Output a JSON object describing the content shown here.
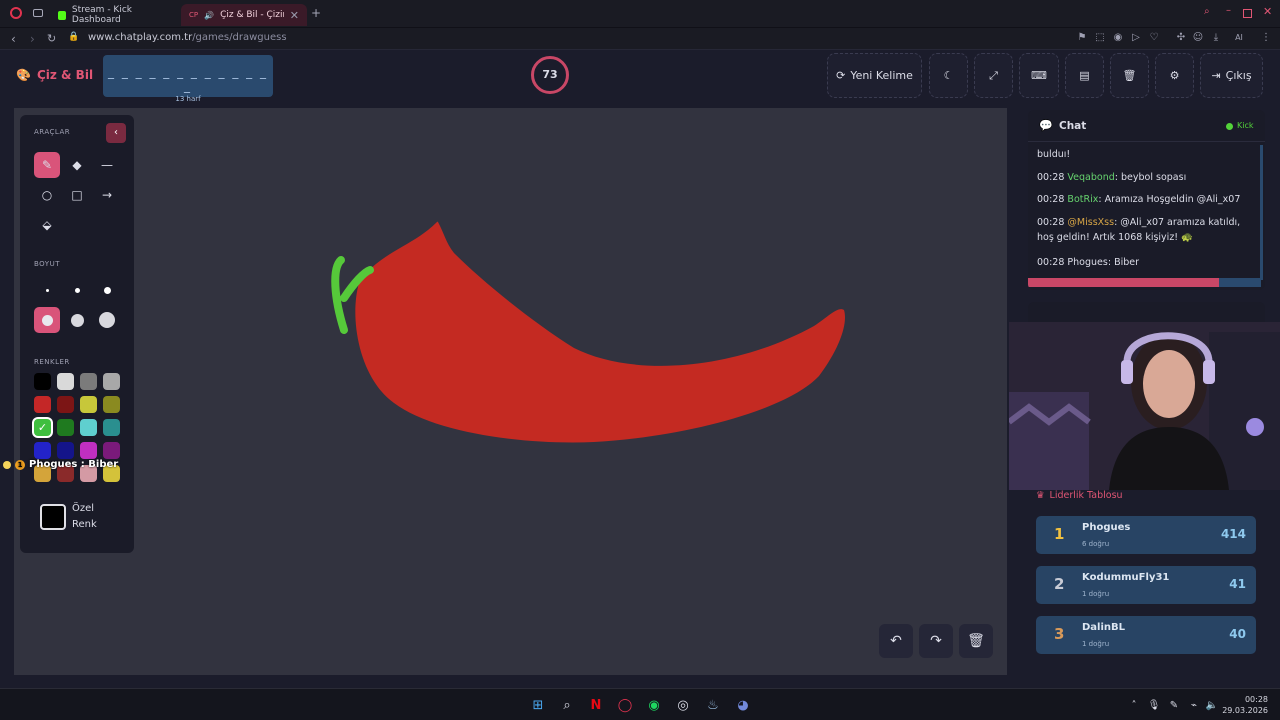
{
  "browser": {
    "tabs": [
      {
        "label": "Stream - Kick Dashboard"
      },
      {
        "label": "Çiz & Bil - Çizim Oy"
      }
    ],
    "url_host": "www.chatplay.com.tr",
    "url_path": "/games/drawguess",
    "ai_label": "AI"
  },
  "header": {
    "brand": "Çiz & Bil",
    "word_dashes": "_ _ _ _ _ _ _ _ _ _ _ _ _",
    "word_length": "13 harf",
    "timer": "73",
    "new_word_label": "Yeni Kelime",
    "exit_label": "Çıkış"
  },
  "tools": {
    "tools_title": "ARAÇLAR",
    "size_title": "BOYUT",
    "colors_title": "RENKLER",
    "custom_color_label_1": "Özel",
    "custom_color_label_2": "Renk",
    "colors": [
      "#000000",
      "#d9d9d9",
      "#7b7b7b",
      "#a8a8a8",
      "#c42727",
      "#7c1515",
      "#c7c73a",
      "#8a8a20",
      "#3fbf3f",
      "#1f7a1f",
      "#5fcfcf",
      "#2a8f8f",
      "#2323c9",
      "#14148a",
      "#c02fc0",
      "#7a1a7a",
      "#d4a43a",
      "#8a2a2a",
      "#d49aa4",
      "#d4c23a"
    ],
    "selected_color": "#3fbf3f"
  },
  "guess_bubble": {
    "badge": "1",
    "text": "Phogues : Biber"
  },
  "chat": {
    "title": "Chat",
    "platform": "Kick",
    "messages": [
      {
        "text": "bulduı!"
      },
      {
        "time": "00:28",
        "user": "Veqabond",
        "text": ": beybol sopası"
      },
      {
        "time": "00:28",
        "user": "BotRix",
        "text": ": Aramıza Hoşgeldin @Ali_x07"
      },
      {
        "time": "00:28",
        "user": "@MissXss",
        "text": ": @Ali_x07 aramıza katıldı, hoş geldin! Artık 1068 kişiyiz! 🐢"
      },
      {
        "time": "00:28",
        "user": "Phogues",
        "text": ": Biber"
      }
    ]
  },
  "leaderboard": {
    "title": "Liderlik Tablosu",
    "rows": [
      {
        "rank": "1",
        "name": "Phogues",
        "sub": "6 doğru",
        "score": "414"
      },
      {
        "rank": "2",
        "name": "KodummuFly31",
        "sub": "1 doğru",
        "score": "41"
      },
      {
        "rank": "3",
        "name": "DalinBL",
        "sub": "1 doğru",
        "score": "40"
      }
    ]
  },
  "taskbar": {
    "time": "00:28",
    "date": "29.03.2026"
  }
}
